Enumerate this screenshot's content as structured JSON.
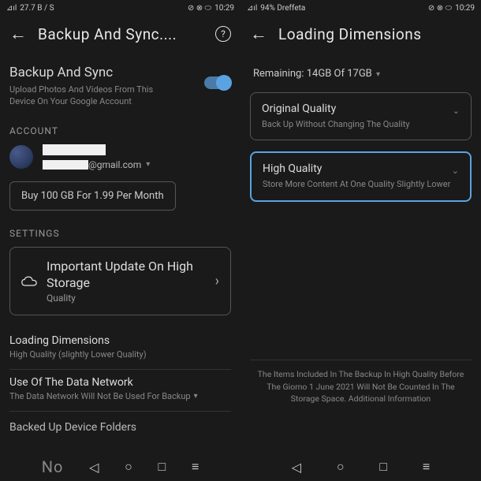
{
  "left": {
    "status": {
      "signal": "⊿ıl",
      "speed": "27.7 B / S",
      "icons": "⊘ ⊗ ⬭",
      "time": "10:29"
    },
    "header": {
      "title": "Backup And Sync...."
    },
    "bs": {
      "title": "Backup And Sync",
      "sub1": "Upload Photos And Videos From This",
      "sub2": "Device On Your Google Account"
    },
    "account": {
      "label": "ACCOUNT",
      "email": "@gmail.com"
    },
    "buy": "Buy 100 GB For 1.99 Per Month",
    "settings": {
      "label": "SETTINGS",
      "card_title": "Important Update On High Storage",
      "card_sub": "Quality"
    },
    "items": [
      {
        "title": "Loading Dimensions",
        "sub": "High Quality (slightly Lower Quality)"
      },
      {
        "title": "Use Of The Data Network",
        "sub": "The Data Network Will Not Be Used For Backup"
      }
    ],
    "footer": "Backed Up Device Folders",
    "nav_no": "No"
  },
  "right": {
    "status": {
      "signal": "⊿ıl",
      "net": "94% Dreffeta",
      "icons": "⊘ ⊗ ⬭",
      "time": "10:29"
    },
    "header": {
      "title": "Loading Dimensions"
    },
    "remaining": "Remaining: 14GB Of 17GB",
    "options": [
      {
        "title": "Original Quality",
        "sub": "Back Up Without Changing The Quality"
      },
      {
        "title": "High Quality",
        "sub": "Store More Content At One Quality Slightly Lower"
      }
    ],
    "footnote": "The Items Included In The Backup In High Quality Before The Giomo 1 June 2021 Will Not Be Counted In The Storage Space. Additional Information"
  }
}
